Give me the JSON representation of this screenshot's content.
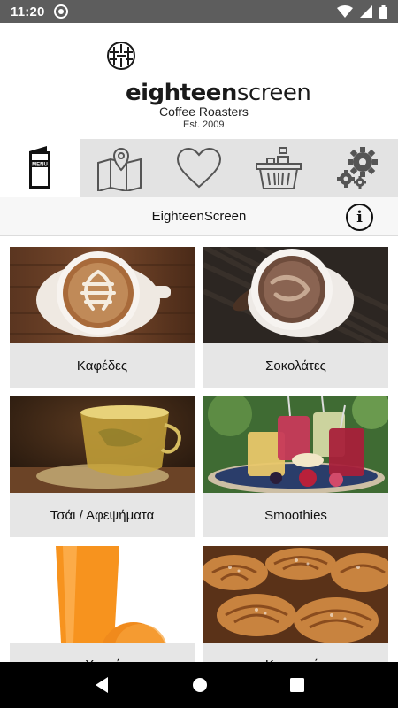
{
  "status_bar": {
    "time": "11:20"
  },
  "header": {
    "logo_word_bold": "eighteen",
    "logo_word_rest": "screen",
    "logo_subtitle": "Coffee Roasters",
    "logo_est": "Est. 2009"
  },
  "nav": {
    "menu_icon_text": "MENU"
  },
  "titlebar": {
    "title": "EighteenScreen",
    "info_glyph": "i"
  },
  "categories": [
    {
      "label": "Καφέδες"
    },
    {
      "label": "Σοκολάτες"
    },
    {
      "label": "Τσάι / Αφεψήματα"
    },
    {
      "label": "Smoothies"
    },
    {
      "label": "Χυμοί"
    },
    {
      "label": "Κρουασάν"
    }
  ]
}
